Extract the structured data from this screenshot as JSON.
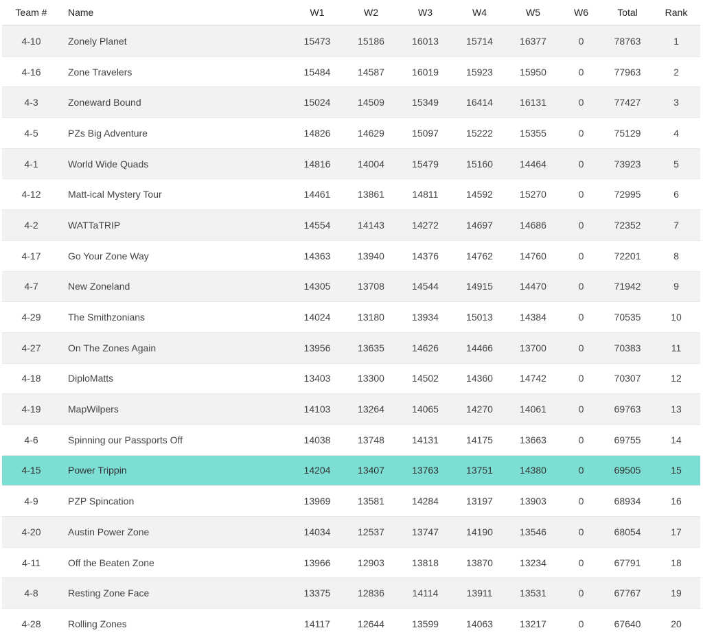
{
  "headers": [
    "Team #",
    "Name",
    "W1",
    "W2",
    "W3",
    "W4",
    "W5",
    "W6",
    "Total",
    "Rank"
  ],
  "highlight_color": "#7ddfd3",
  "highlighted_rank": 15,
  "rows": [
    [
      "4-10",
      "Zonely Planet",
      "15473",
      "15186",
      "16013",
      "15714",
      "16377",
      "0",
      "78763",
      "1"
    ],
    [
      "4-16",
      "Zone Travelers",
      "15484",
      "14587",
      "16019",
      "15923",
      "15950",
      "0",
      "77963",
      "2"
    ],
    [
      "4-3",
      "Zoneward Bound",
      "15024",
      "14509",
      "15349",
      "16414",
      "16131",
      "0",
      "77427",
      "3"
    ],
    [
      "4-5",
      "PZs Big Adventure",
      "14826",
      "14629",
      "15097",
      "15222",
      "15355",
      "0",
      "75129",
      "4"
    ],
    [
      "4-1",
      "World Wide Quads",
      "14816",
      "14004",
      "15479",
      "15160",
      "14464",
      "0",
      "73923",
      "5"
    ],
    [
      "4-12",
      "Matt-ical Mystery Tour",
      "14461",
      "13861",
      "14811",
      "14592",
      "15270",
      "0",
      "72995",
      "6"
    ],
    [
      "4-2",
      "WATTaTRIP",
      "14554",
      "14143",
      "14272",
      "14697",
      "14686",
      "0",
      "72352",
      "7"
    ],
    [
      "4-17",
      "Go Your Zone Way",
      "14363",
      "13940",
      "14376",
      "14762",
      "14760",
      "0",
      "72201",
      "8"
    ],
    [
      "4-7",
      "New Zoneland",
      "14305",
      "13708",
      "14544",
      "14915",
      "14470",
      "0",
      "71942",
      "9"
    ],
    [
      "4-29",
      "The Smithzonians",
      "14024",
      "13180",
      "13934",
      "15013",
      "14384",
      "0",
      "70535",
      "10"
    ],
    [
      "4-27",
      "On The Zones Again",
      "13956",
      "13635",
      "14626",
      "14466",
      "13700",
      "0",
      "70383",
      "11"
    ],
    [
      "4-18",
      "DiploMatts",
      "13403",
      "13300",
      "14502",
      "14360",
      "14742",
      "0",
      "70307",
      "12"
    ],
    [
      "4-19",
      "MapWilpers",
      "14103",
      "13264",
      "14065",
      "14270",
      "14061",
      "0",
      "69763",
      "13"
    ],
    [
      "4-6",
      "Spinning our Passports Off",
      "14038",
      "13748",
      "14131",
      "14175",
      "13663",
      "0",
      "69755",
      "14"
    ],
    [
      "4-15",
      "Power Trippin",
      "14204",
      "13407",
      "13763",
      "13751",
      "14380",
      "0",
      "69505",
      "15"
    ],
    [
      "4-9",
      "PZP Spincation",
      "13969",
      "13581",
      "14284",
      "13197",
      "13903",
      "0",
      "68934",
      "16"
    ],
    [
      "4-20",
      "Austin Power Zone",
      "14034",
      "12537",
      "13747",
      "14190",
      "13546",
      "0",
      "68054",
      "17"
    ],
    [
      "4-11",
      "Off the Beaten Zone",
      "13966",
      "12903",
      "13818",
      "13870",
      "13234",
      "0",
      "67791",
      "18"
    ],
    [
      "4-8",
      "Resting Zone Face",
      "13375",
      "12836",
      "14114",
      "13911",
      "13531",
      "0",
      "67767",
      "19"
    ],
    [
      "4-28",
      "Rolling Zones",
      "14117",
      "12644",
      "13599",
      "14063",
      "13217",
      "0",
      "67640",
      "20"
    ]
  ]
}
